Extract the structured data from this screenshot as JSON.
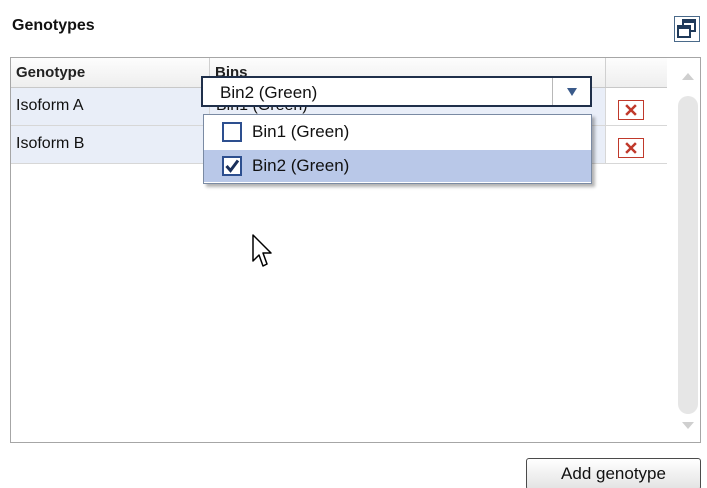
{
  "panel": {
    "title": "Genotypes",
    "popout_icon": "popout-window-icon"
  },
  "table": {
    "columns": [
      "Genotype",
      "Bins",
      ""
    ],
    "rows": [
      {
        "genotype": "Isoform A",
        "bins": "Bin1 (Green)",
        "delete_icon": "delete-x-icon"
      },
      {
        "genotype": "Isoform B",
        "bins": "Bin2 (Green)",
        "delete_icon": "delete-x-icon",
        "editing": true
      }
    ]
  },
  "bins_select": {
    "value": "Bin2 (Green)",
    "arrow_icon": "dropdown-arrow-icon",
    "options": [
      {
        "label": "Bin1 (Green)",
        "checked": false
      },
      {
        "label": "Bin2 (Green)",
        "checked": true
      }
    ]
  },
  "actions": {
    "add_label": "Add genotype"
  },
  "colors": {
    "row_bg": "#e9eef8",
    "selected_option_bg": "#b9c8e8",
    "delete_red": "#c0392b",
    "checkbox_blue": "#2d4f8f"
  }
}
